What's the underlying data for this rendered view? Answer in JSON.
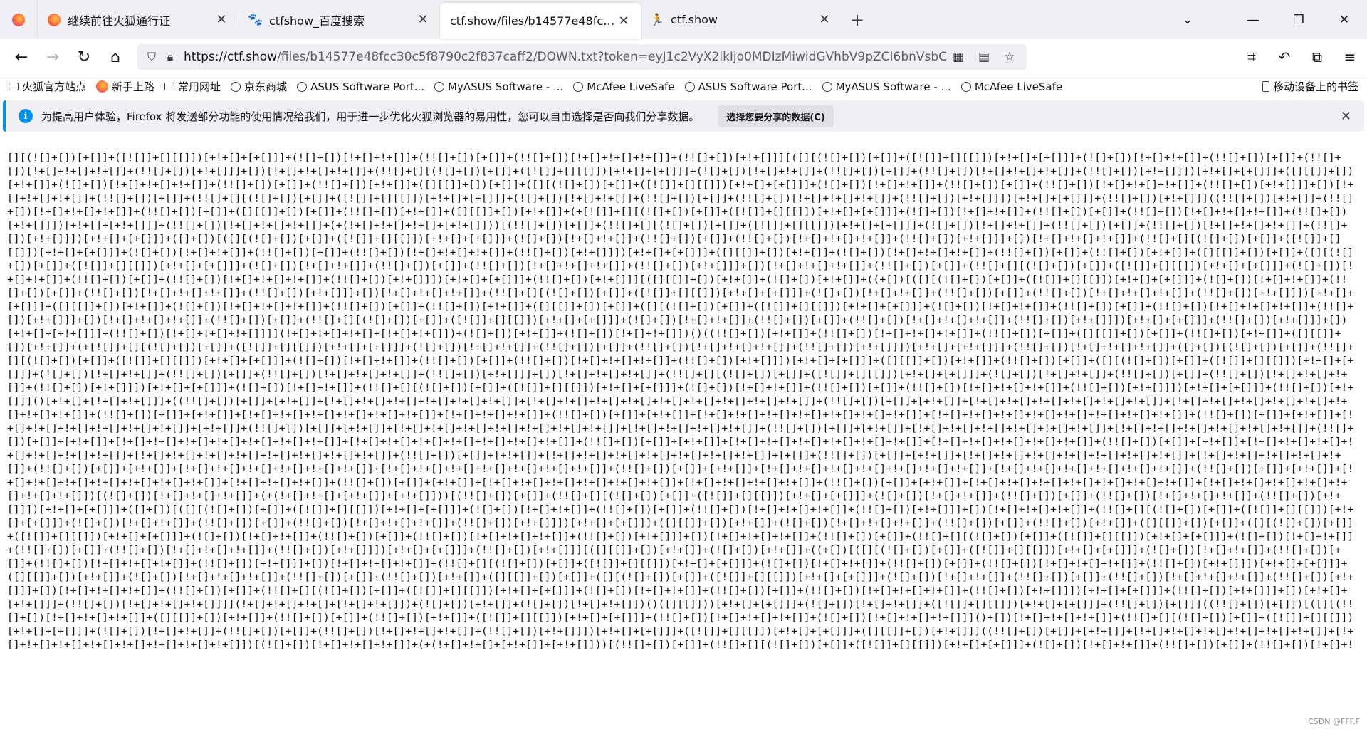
{
  "tabs": [
    {
      "title": "继续前往火狐通行证",
      "favicon": "firefox-icon",
      "active": false
    },
    {
      "title": "ctfshow_百度搜索",
      "favicon": "baidu-paw-icon",
      "active": false
    },
    {
      "title": "ctf.show/files/b14577e48fcc30c5f",
      "favicon": "none",
      "active": true
    },
    {
      "title": "ctf.show",
      "favicon": "ctfshow-runner-icon",
      "active": false
    }
  ],
  "navbar": {
    "url_host": "https://ctf.show",
    "url_path": "/files/b14577e48fcc30c5f8790c2f837caff2/DOWN.txt?token=eyJ1c2VyX2lkIjo0MDIzMiwidGVhbV9pZCI6bnVsbCwi"
  },
  "bookmarks": [
    {
      "label": "火狐官方站点",
      "icon": "folder-icon"
    },
    {
      "label": "新手上路",
      "icon": "firefox-icon"
    },
    {
      "label": "常用网址",
      "icon": "folder-icon"
    },
    {
      "label": "京东商城",
      "icon": "globe-icon"
    },
    {
      "label": "ASUS Software Port...",
      "icon": "globe-icon"
    },
    {
      "label": "MyASUS Software - ...",
      "icon": "globe-icon"
    },
    {
      "label": "McAfee LiveSafe",
      "icon": "globe-icon"
    },
    {
      "label": "ASUS Software Port...",
      "icon": "globe-icon"
    },
    {
      "label": "MyASUS Software - ...",
      "icon": "globe-icon"
    },
    {
      "label": "McAfee LiveSafe",
      "icon": "globe-icon"
    }
  ],
  "mobile_bookmarks": "移动设备上的书签",
  "notification": {
    "message": "为提高用户体验，Firefox 将发送部分功能的使用情况给我们，用于进一步优化火狐浏览器的易用性，您可以自由选择是否向我们分享数据。",
    "button": "选择您要分享的数据(C)"
  },
  "content": {
    "text": "[][(![]+[])[+[]]+([![]]+[][[]])[+!+[]+[+[]]]+(![]+[])[!+[]+!+[]]+(!![]+[])[+[]]+(!![]+[])[!+[]+!+[]+!+[]]+(!![]+[])[+!+[]]][([][(![]+[])[+[]]+([![]]+[][[]])[+!+[]+[+[]]]+(![]+[])[!+[]+!+[]]+(!![]+[])[+[]]+(!![]+[])[!+[]+!+[]+!+[]]+(!![]+[])[+!+[]]]+[])[!+[]+!+[]+!+[]]+(!![]+[][(![]+[])[+[]]+([![]]+[][[]])[+!+[]+[+[]]]+(![]+[])[!+[]+!+[]]+(!![]+[])[+[]]+(!![]+[])[!+[]+!+[]+!+[]]+(!![]+[])[+!+[]]])[+!+[]+[+[]]]+([][[]]+[])[+!+[]]+(![]+[])[!+[]+!+[]+!+[]]+(!![]+[])[+[]]+(!![]+[])[+!+[]]+([][[]]+[])[+[]]+([][(![]+[])[+[]]+([![]]+[][[]])[+!+[]+[+[]]]+(![]+[])[!+[]+!+[]]+(!![]+[])[+[]]+(!![]+[])[!+[]+!+[]+!+[]]+(!![]+[])[+!+[]]]+[])[!+[]+!+[]+!+[]]+(!![]+[])[+[]]+(!![]+[][(![]+[])[+[]]+([![]]+[][[]])[+!+[]+[+[]]]+(![]+[])[!+[]+!+[]]+(!![]+[])[+[]]+(!![]+[])[!+[]+!+[]+!+[]]+(!![]+[])[+!+[]]])[+!+[]+[+[]]]+(!![]+[])[+!+[]]]((!![]+[])[+!+[]]+(!![]+[])[!+[]+!+[]+!+[]]+(!![]+[])[+[]]+([][[]]+[])[+[]]+(!![]+[])[+!+[]]+([][[]]+[])[+!+[]]+(+[![]]+[][(![]+[])[+[]]+([![]]+[][[]])[+!+[]+[+[]]]+(![]+[])[!+[]+!+[]]+(!![]+[])[+[]]+(!![]+[])[!+[]+!+[]+!+[]]+(!![]+[])[+!+[]]])[+!+[]+[+!+[]]]+(!![]+[])[!+[]+!+[]+!+[]]+(+(!+[]+!+[]+!+[]+[+!+[]]))[(!![]+[])[+[]]+(!![]+[][(![]+[])[+[]]+([![]]+[][[]])[+!+[]+[+[]]]+(![]+[])[!+[]+!+[]]+(!![]+[])[+[]]+(!![]+[])[!+[]+!+[]+!+[]]+(!![]+[])[+!+[]]])[+!+[]+[+[]]]+([]+[])[([][(![]+[])[+[]]+([![]]+[][[]])[+!+[]+[+[]]]+(![]+[])[!+[]+!+[]]+(!![]+[])[+[]]+(!![]+[])[!+[]+!+[]+!+[]]+(!![]+[])[+!+[]]]+[])[!+[]+!+[]+!+[]]+(!![]+[][(![]+[])[+[]]+([![]]+[][[]])[+!+[]+[+[]]]+(![]+[])[!+[]+!+[]]+(!![]+[])[+[]]+(!![]+[])[!+[]+!+[]+!+[]]+(!![]+[])[+!+[]]])[+!+[]+[+[]]]+([][[]]+[])[+!+[]]+(![]+[])[!+[]+!+[]+!+[]]+(!![]+[])[+[]]+(!![]+[])[+!+[]]+([][[]]+[])[+[]]+([][(![]+[])[+[]]+([![]]+[][[]])[+!+[]+[+[]]]+(![]+[])[!+[]+!+[]]+(!![]+[])[+[]]+(!![]+[])[!+[]+!+[]+!+[]]+(!![]+[])[+!+[]]]+[])[!+[]+!+[]+!+[]]+(!![]+[])[+[]]+(!![]+[][(![]+[])[+[]]+([![]]+[][[]])[+!+[]+[+[]]]+(![]+[])[!+[]+!+[]]+(!![]+[])[+[]]+(!![]+[])[!+[]+!+[]+!+[]]+(!![]+[])[+!+[]]])[+!+[]+[+[]]]+(!![]+[])[+!+[]]][([][[]]+[])[+!+[]]+(![]+[])[+!+[]]+((+[])[([][(![]+[])[+[]]+([![]]+[][[]])[+!+[]+[+[]]]+(![]+[])[!+[]+!+[]]+(!![]+[])[+[]]+(!![]+[])[!+[]+!+[]+!+[]]+(!![]+[])[+!+[]]]+[])[!+[]+!+[]+!+[]]+(!![]+[][(![]+[])[+[]]+([![]]+[][[]])[+!+[]+[+[]]]+(![]+[])[!+[]+!+[]]+(!![]+[])[+[]]+(!![]+[])[!+[]+!+[]+!+[]]+(!![]+[])[+!+[]]])[+!+[]+[+[]]]+([][[]]+[])[+!+[]]+(![]+[])[!+[]+!+[]+!+[]]+(!![]+[])[+[]]+(!![]+[])[+!+[]]+([][[]]+[])[+[]]+([][(![]+[])[+[]]+([![]]+[][[]])[+!+[]+[+[]]]+(![]+[])[!+[]+!+[]]+(!![]+[])[+[]]+(!![]+[])[!+[]+!+[]+!+[]]+(!![]+[])[+!+[]]]+[])[!+[]+!+[]+!+[]]+(!![]+[])[+[]]+(!![]+[][(![]+[])[+[]]+([![]]+[][[]])[+!+[]+[+[]]]+(![]+[])[!+[]+!+[]]+(!![]+[])[+[]]+(!![]+[])[!+[]+!+[]+!+[]]+(!![]+[])[+!+[]]])[+!+[]+[+[]]]+(!![]+[])[+!+[]]]+[])[+!+[]+[+!+[]]]+(!![]+[])[!+[]+!+[]+!+[]]]](!+[]+!+[]+!+[]+[!+[]+!+[]])+(![]+[])[+!+[]]+(![]+[])[!+[]+!+[]])()((!![]+[])[+!+[]]+(!![]+[])[!+[]+!+[]+!+[]]+(!![]+[])[+[]]+([][[]]+[])[+[]]+(!![]+[])[+!+[]]+([][[]]+[])[+!+[]]+(+[![]]+[][(![]+[])[+[]]+([![]]+[][[]])[+!+[]+[+[]]]+(![]+[])[!+[]+!+[]]+(!![]+[])[+[]]+(!![]+[])[!+[]+!+[]+!+[]]+(!![]+[])[+!+[]]])[+!+[]+[+!+[]]]+(!![]+[])[!+[]+!+[]+!+[]]+([]+[])[(![]+[])[+[]]+(!![]+[][(![]+[])[+[]]+([![]]+[][[]])[+!+[]+[+[]]]+(![]+[])[!+[]+!+[]]+(!![]+[])[+[]]+(!![]+[])[!+[]+!+[]+!+[]]+(!![]+[])[+!+[]]])[+!+[]+[+[]]]+([][[]]+[])[+!+[]]+(!![]+[])[+[]]+([][(![]+[])[+[]]+([![]]+[][[]])[+!+[]+[+[]]]+(![]+[])[!+[]+!+[]]+(!![]+[])[+[]]+(!![]+[])[!+[]+!+[]+!+[]]+(!![]+[])[+!+[]]]+[])[!+[]+!+[]+!+[]]+(!![]+[][(![]+[])[+[]]+([![]]+[][[]])[+!+[]+[+[]]]+(![]+[])[!+[]+!+[]]+(!![]+[])[+[]]+(!![]+[])[!+[]+!+[]+!+[]]+(!![]+[])[+!+[]]])[+!+[]+[+[]]]+(![]+[])[!+[]+!+[]]+(!![]+[][(![]+[])[+[]]+([![]]+[][[]])[+!+[]+[+[]]]+(![]+[])[!+[]+!+[]]+(!![]+[])[+[]]+(!![]+[])[!+[]+!+[]+!+[]]+(!![]+[])[+!+[]]])[+!+[]+[+[]]]+(!![]+[])[+!+[]]]()[+!+[]+[!+[]+!+[]]]+((!![]+[])[+[]]+[+!+[]]+[!+[]+!+[]+!+[]+!+[]+!+[]+!+[]]+[!+[]+!+[]+!+[]+!+[]+!+[]+!+[]+!+[]+!+[]+!+[]]+(!![]+[])[+[]]+[+!+[]]+[!+[]+!+[]+!+[]+!+[]+!+[]+!+[]]+[!+[]+!+[]+!+[]+!+[]+!+[]+!+[]+!+[]+!+[]]+(!![]+[])[+[]]+[+!+[]]+[!+[]+!+[]+!+[]+!+[]+!+[]+!+[]]+[!+[]+!+[]+!+[]]+(!![]+[])[+[]]+[+!+[]]+[!+[]+!+[]+!+[]+!+[]+!+[]+!+[]+!+[]]+[!+[]+!+[]+!+[]+!+[]+!+[]+!+[]+!+[]+!+[]]+(!![]+[])[+[]]+[+!+[]]+[!+[]+!+[]+!+[]+!+[]+!+[]+!+[]]+[+!+[]]+(!![]+[])[+[]]+[+!+[]]+[!+[]+!+[]+!+[]+!+[]+!+[]+!+[]+!+[]]+[!+[]+!+[]+!+[]+!+[]]+(!![]+[])[+[]]+[+!+[]]+[!+[]+!+[]+!+[]+!+[]+!+[]+!+[]]+[!+[]+!+[]+!+[]+!+[]+!+[]+!+[]]+(!![]+[])[+[]]+[+!+[]]+[!+[]+!+[]+!+[]+!+[]+!+[]+!+[]+!+[]]+[!+[]+!+[]+!+[]+!+[]+!+[]+!+[]+!+[]]+(!![]+[])[+[]]+[+!+[]]+[!+[]+!+[]+!+[]+!+[]+!+[]+!+[]]+[!+[]+!+[]+!+[]+!+[]+!+[]]+(!![]+[])[+[]]+[+!+[]]+[!+[]+!+[]+!+[]+!+[]+!+[]+!+[]+!+[]]+[!+[]+!+[]+!+[]+!+[]+!+[]+!+[]+!+[]+!+[]]+(!![]+[])[+[]]+[+!+[]]+[!+[]+!+[]+!+[]+!+[]+!+[]+!+[]+!+[]]+[+[]]+(!![]+[])[+[]]+[+!+[]]+[!+[]+!+[]+!+[]+!+[]+!+[]+!+[]+!+[]]+[!+[]+!+[]+!+[]+!+[]+!+[]]+(!![]+[])[+[]]+[+!+[]]+[!+[]+!+[]+!+[]+!+[]+!+[]+!+[]]+[!+[]+!+[]+!+[]+!+[]+!+[]+!+[]+!+[]]+(!![]+[])[+[]]+[+!+[]]+[!+[]+!+[]+!+[]+!+[]+!+[]+!+[]+!+[]]+[!+[]+!+[]+!+[]+!+[]+!+[]+!+[]]+(!![]+[])[+[]]+[+!+[]]+[!+[]+!+[]+!+[]+!+[]+!+[]+!+[]+!+[]]+[!+[]+!+[]+!+[]]+(!![]+[])[+[]]+[+!+[]]+[!+[]+!+[]+!+[]+!+[]+!+[]+!+[]]+[!+[]+!+[]+!+[]+!+[]]+(!![]+[])[+[]]+[+!+[]]+[!+[]+!+[]+!+[]+!+[]+!+[]+!+[]+!+[]]+[!+[]+!+[]+!+[]+!+[]+!+[]+!+[]+!+[]])[(![]+[])[!+[]+!+[]+!+[]]+(+(!+[]+!+[]+[+!+[]]+[+!+[]]))[(!![]+[])[+[]]+(!![]+[][(![]+[])[+[]]+([![]]+[][[]])[+!+[]+[+[]]]+(![]+[])[!+[]+!+[]]+(!![]+[])[+[]]+(!![]+[])[!+[]+!+[]+!+[]]+(!![]+[])[+!+[]]])[+!+[]+[+[]]]+([]+[])[([][(![]+[])[+[]]+([![]]+[][[]])[+!+[]+[+[]]]+(![]+[])[!+[]+!+[]]+(!![]+[])[+[]]+(!![]+[])[!+[]+!+[]+!+[]]+(!![]+[])[+!+[]]]+[])[!+[]+!+[]+!+[]]+(!![]+[][(![]+[])[+[]]+([![]]+[][[]])[+!+[]+[+[]]]+(![]+[])[!+[]+!+[]]+(!![]+[])[+[]]+(!![]+[])[!+[]+!+[]+!+[]]+(!![]+[])[+!+[]]])[+!+[]+[+[]]]+([][[]]+[])[+!+[]]+(![]+[])[!+[]+!+[]+!+[]]+(!![]+[])[+[]]+(!![]+[])[+!+[]]+([][[]]+[])[+[]]+([][(![]+[])[+[]]+([![]]+[][[]])[+!+[]+[+[]]]+(![]+[])[!+[]+!+[]]+(!![]+[])[+[]]+(!![]+[])[!+[]+!+[]+!+[]]+(!![]+[])[+!+[]]]+[])[!+[]+!+[]+!+[]]+(!![]+[])[+[]]+(!![]+[][(![]+[])[+[]]+([![]]+[][[]])[+!+[]+[+[]]]+(![]+[])[!+[]+!+[]]+(!![]+[])[+[]]+(!![]+[])[!+[]+!+[]+!+[]]+(!![]+[])[+!+[]]])[+!+[]+[+[]]]+(!![]+[])[+!+[]]][([][[]]+[])[+!+[]]+(![]+[])[+!+[]]+((+[])[([][(![]+[])[+[]]+([![]]+[][[]])[+!+[]+[+[]]]+(![]+[])[!+[]+!+[]]+(!![]+[])[+[]]+(!![]+[])[!+[]+!+[]+!+[]]+(!![]+[])[+!+[]]]+[])[!+[]+!+[]+!+[]]+(!![]+[][(![]+[])[+[]]+([![]]+[][[]])[+!+[]+[+[]]]+(![]+[])[!+[]+!+[]]+(!![]+[])[+[]]+(!![]+[])[!+[]+!+[]+!+[]]+(!![]+[])[+!+[]]])[+!+[]+[+[]]]+([][[]]+[])[+!+[]]+(![]+[])[!+[]+!+[]+!+[]]+(!![]+[])[+[]]+(!![]+[])[+!+[]]+([][[]]+[])[+[]]+([][(![]+[])[+[]]+([![]]+[][[]])[+!+[]+[+[]]]+(![]+[])[!+[]+!+[]]+(!![]+[])[+[]]+(!![]+[])[!+[]+!+[]+!+[]]+(!![]+[])[+!+[]]]+[])[!+[]+!+[]+!+[]]+(!![]+[])[+[]]+(!![]+[][(![]+[])[+[]]+([![]]+[][[]])[+!+[]+[+[]]]+(![]+[])[!+[]+!+[]]+(!![]+[])[+[]]+(!![]+[])[!+[]+!+[]+!+[]]+(!![]+[])[+!+[]]])[+!+[]+[+[]]]+(!![]+[])[+!+[]]]+[])[+!+[]+[+!+[]]]+(!![]+[])[!+[]+!+[]+!+[]]]](!+[]+!+[]+!+[]+[!+[]+!+[]])+(![]+[])[+!+[]]+(![]+[])[!+[]+!+[]])()([][[]]))[+!+[]+[+[]]]+(![]+[])[!+[]+!+[]]+([![]]+[][[]])[+!+[]+[+[]]]+(!![]+[])[+[]]]((!![]+[])[+[]])[([][(!![]+[])[!+[]+!+[]+!+[]]+([][[]]+[])[+!+[]]+(!![]+[])[+[]]+(!![]+[])[+!+[]]+([![]]+[][[]])[+!+[]+[+[]]]+(!![]+[])[!+[]+!+[]+!+[]]+(![]+[])[!+[]+!+[]+!+[]]]()+[])[!+[]+!+[]+!+[]]+(!![]+[][(![]+[])[+[]]+([![]]+[][[]])[+!+[]+[+[]]]+(![]+[])[!+[]+!+[]]+(!![]+[])[+[]]+(!![]+[])[!+[]+!+[]+!+[]]+(!![]+[])[+!+[]]])[+!+[]+[+[]]]+([![]]+[][[]])[+!+[]+[+[]]]+([][[]]+[])[+!+[]]]((!![]+[])[+[]]+[+!+[]]+[!+[]+!+[]+!+[]+!+[]+!+[]+!+[]]+[!+[]+!+[]+!+[]+!+[]+!+[]+!+[]+!+[]+!+[]])[(![]+[])[!+[]+!+[]+!+[]]+(+(!+[]+!+[]+[+!+[]]+[+!+[]]))[(!![]+[])[+[]]+(!![]+[][(![]+[])[+[]]+([![]]+[][[]])[+!+[]+[+[]]]+(![]+[])[!+[]+!+[]]+(!![]+[])[+[]]+(!![]+[])[!+[]+!+[]+!+[]]+(!![]+[])[+!+[]]])[+!+[]+[+[]]]+([]+[])[([][(![]+[])[+[]]+([![]]+[][[]])[+!+[]+[+[]]]+(![]+[])[!+[]+!+[]]+(!![]+[])[+[]]+(!![]+[])[!+[]+!+[]+!+[]]+(!![]+[])[+!+[]]]+[])[!+[]+!+[]+!+[]]+(!![]+[][(![]+[])[+[]]+([![]]+[][[]])[+!+[]+[+[]]]+(![]+[])[!+[]+!+[]]+(!![]+[])[+[]]+(!![]+[])[!+[]+!+[]+!+[]]+(!![]+[])[+!+[]]])[+!+[]+[+[]]]+([][[]]+[])[+!+[]]+(![]+[])[!+[]+!+[]+!+[]]+(!![]+[])[+[]]+(!![]+[])[+!+[]]+([][[]]+[])[+[]]+([][(![]+[])[+[]]+([![]]+[][[]])[+!+[]+[+[]]]+(![]+[])[!+[]+!+[]]+(!![]+[])[+[]]+(!![]+[])[!+[]+!+[]+!+[]]+(!![]+[])[+!+[]]]+[])[!+[]+!+[]+!+[]]+(!![]+[])[+[]]+(!![]+[][(![]+[])[+[]]+([![]]+[][[]])[+!+[]+[+[]]]+(![]+[])[!+[]+!+[]]+(!![]+[])[+[]]+(!![]+[])[!+[]+!+[]+!+[]]+(!![]+[])[+!+[]]])[+!+[]+[+[]]]+(!![]+[])[+!+[]]])"
  },
  "watermark": "CSDN @FFF.F"
}
